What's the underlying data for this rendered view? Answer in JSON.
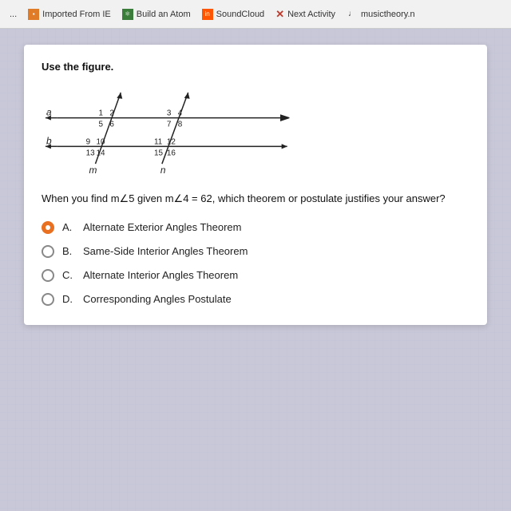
{
  "browser": {
    "back_label": "...",
    "tabs": [
      {
        "label": "Imported From IE",
        "icon_type": "orange",
        "icon_text": "IE"
      },
      {
        "label": "Build an Atom",
        "icon_type": "green",
        "icon_text": "⚛"
      },
      {
        "label": "SoundCloud",
        "icon_type": "soundcloud",
        "icon_text": "in"
      },
      {
        "label": "Next Activity",
        "icon_type": "x"
      },
      {
        "label": "musictheory.n",
        "icon_type": "music"
      }
    ]
  },
  "card": {
    "use_figure_label": "Use the figure.",
    "question": "When you find m∠5 given m∠4 = 62, which theorem or postulate justifies your answer?",
    "options": [
      {
        "letter": "A.",
        "text": "Alternate Exterior Angles Theorem",
        "selected": true
      },
      {
        "letter": "B.",
        "text": "Same-Side Interior Angles Theorem",
        "selected": false
      },
      {
        "letter": "C.",
        "text": "Alternate Interior Angles Theorem",
        "selected": false
      },
      {
        "letter": "D.",
        "text": "Corresponding Angles Postulate",
        "selected": false
      }
    ],
    "figure": {
      "line_a_label": "a",
      "line_b_label": "b",
      "line_m_label": "m",
      "line_n_label": "n",
      "numbers": [
        "1",
        "2",
        "3",
        "4",
        "5",
        "6",
        "7",
        "8",
        "9",
        "10",
        "11",
        "12",
        "13",
        "14",
        "15",
        "16"
      ]
    }
  }
}
